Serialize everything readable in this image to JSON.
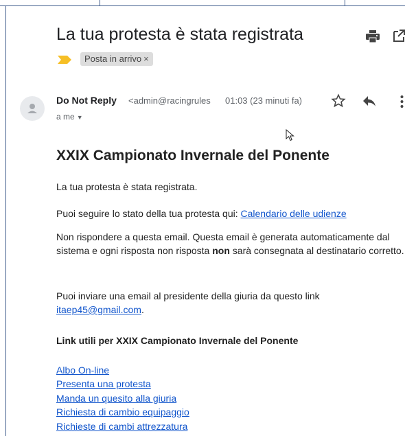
{
  "email": {
    "subject": "La tua protesta è stata registrata",
    "label": "Posta in arrivo",
    "label_close": "×",
    "sender_name": "Do Not Reply",
    "sender_email": "<admin@racingrules",
    "timestamp": "01:03 (23 minuti fa)",
    "to_line": "a me",
    "to_caret": "▼"
  },
  "body": {
    "title": "XXIX Campionato Invernale del Ponente",
    "p1": "La tua protesta è stata registrata.",
    "p2_text": "Puoi seguire lo stato della tua protesta qui: ",
    "p2_link": "Calendario delle udienze",
    "p3_a": "Non rispondere a questa email. Questa email è generata automaticamente dal sistema e ogni risposta non risposta ",
    "p3_bold": "non",
    "p3_b": " sarà consegnata al destinatario corretto.",
    "p4_text": "Puoi inviare una email al presidente della giuria da questo link ",
    "p4_link": "itaep45@gmail.com",
    "p4_end": ".",
    "links_heading": "Link utili per XXIX Campionato Invernale del Ponente",
    "links": [
      "Albo On-line",
      "Presenta una protesta",
      "Manda un quesito alla giuria",
      "Richiesta di cambio equipaggio",
      "Richieste di cambi attrezzatura"
    ]
  },
  "icons": {
    "print": "print-icon",
    "popout": "open-in-new-window-icon",
    "importance": "importance-marker-icon",
    "avatar": "person-avatar-icon",
    "star": "star-icon",
    "reply": "reply-icon",
    "more": "more-vertical-icon",
    "cursor": "mouse-cursor-icon"
  },
  "colors": {
    "link": "#1155cc",
    "importance": "#f6bf26",
    "label_bg": "#dddddd"
  }
}
